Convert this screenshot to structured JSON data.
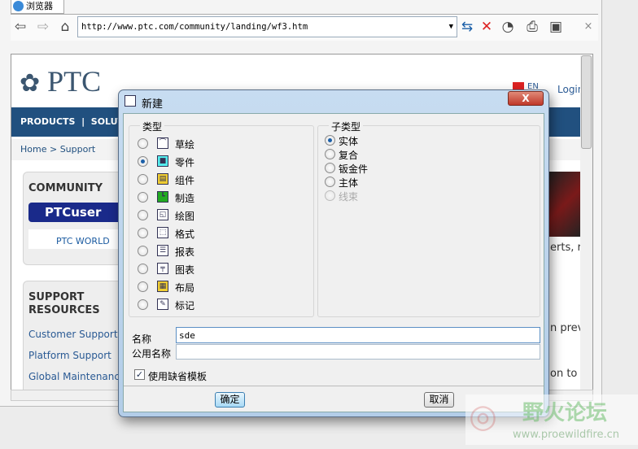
{
  "browser": {
    "tab_title": "浏览器",
    "url": "http://www.ptc.com/community/landing/wf3.htm",
    "close": "×"
  },
  "page": {
    "logo": "PTC",
    "lang": "EN",
    "login": "Login",
    "nav": "PRODUCTS  |  SOLUTIO",
    "breadcrumb": "Home > Support",
    "community": "COMMUNITY",
    "ptcuser": "PTCuser",
    "ptcworld": "PTC WORLD",
    "support": "SUPPORT RESOURCES",
    "links": [
      "Customer Support",
      "Platform Support",
      "Global Maintenance"
    ],
    "snippets": [
      "erts, r",
      "n prev",
      "on to c"
    ]
  },
  "dialog": {
    "title": "新建",
    "close": "X",
    "type_label": "类型",
    "types": [
      {
        "label": "草绘",
        "icon": "sketch-icon"
      },
      {
        "label": "零件",
        "icon": "part-icon",
        "selected": true
      },
      {
        "label": "组件",
        "icon": "assembly-icon"
      },
      {
        "label": "制造",
        "icon": "manufacturing-icon"
      },
      {
        "label": "绘图",
        "icon": "drawing-icon"
      },
      {
        "label": "格式",
        "icon": "format-icon"
      },
      {
        "label": "报表",
        "icon": "report-icon"
      },
      {
        "label": "图表",
        "icon": "diagram-icon"
      },
      {
        "label": "布局",
        "icon": "layout-icon"
      },
      {
        "label": "标记",
        "icon": "markup-icon"
      }
    ],
    "subtype_label": "子类型",
    "subtypes": [
      {
        "label": "实体",
        "selected": true
      },
      {
        "label": "复合"
      },
      {
        "label": "钣金件"
      },
      {
        "label": "主体"
      },
      {
        "label": "线束",
        "disabled": true
      }
    ],
    "name_label": "名称",
    "name_value": "sde",
    "common_name_label": "公用名称",
    "common_name_value": "",
    "use_template": "使用缺省模板",
    "use_template_checked": true,
    "ok": "确定",
    "cancel": "取消"
  },
  "watermark": {
    "title": "野火论坛",
    "url": "www.proewildfire.cn"
  },
  "colors": {
    "nav": "#21507f",
    "link": "#2a5a94",
    "accent": "#1b5fa8"
  }
}
